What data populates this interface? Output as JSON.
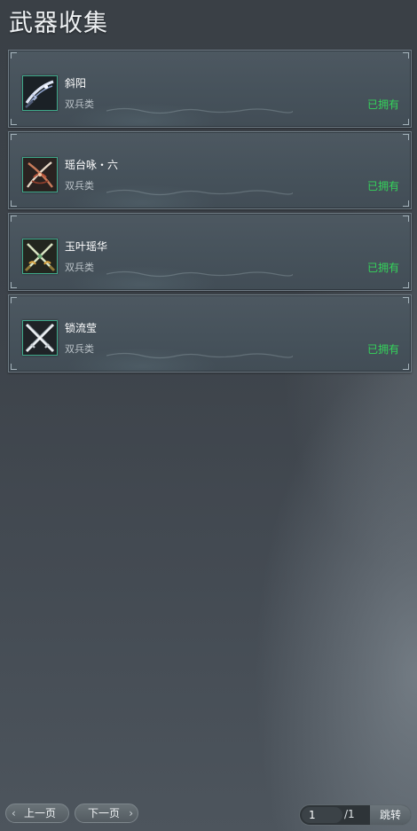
{
  "page_title": "武器收集",
  "weapons": [
    {
      "name": "斜阳",
      "type": "双兵类",
      "status": "已拥有",
      "icon": "curved-blade-icon"
    },
    {
      "name": "瑶台咏・六",
      "type": "双兵类",
      "status": "已拥有",
      "icon": "ornate-blades-icon"
    },
    {
      "name": "玉叶瑶华",
      "type": "双兵类",
      "status": "已拥有",
      "icon": "crossed-jade-swords-icon"
    },
    {
      "name": "锁流莹",
      "type": "双兵类",
      "status": "已拥有",
      "icon": "crossed-steel-swords-icon"
    }
  ],
  "pagination": {
    "prev_label": "上一页",
    "next_label": "下一页",
    "current_page": "1",
    "total_label": "/1",
    "jump_label": "跳转"
  },
  "colors": {
    "owned_status": "#34d45a",
    "icon_border": "#3fa98a",
    "card_background": "#4a555e"
  }
}
